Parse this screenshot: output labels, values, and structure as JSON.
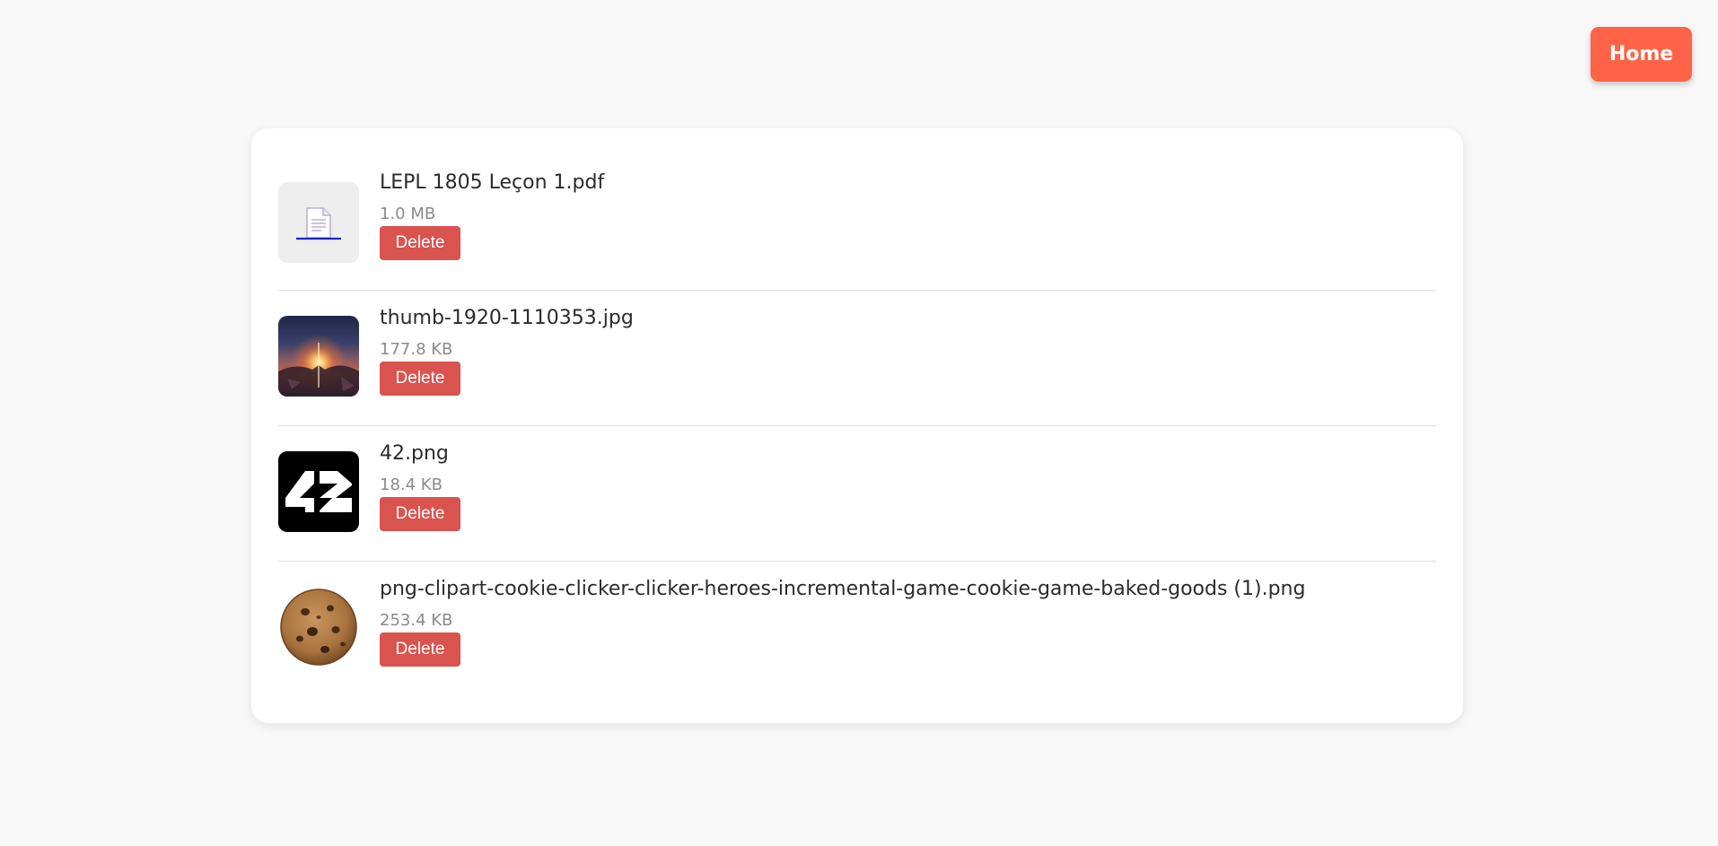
{
  "header": {
    "home_label": "Home"
  },
  "files": [
    {
      "name": "LEPL 1805 Leçon 1.pdf",
      "size": "1.0 MB",
      "delete_label": "Delete",
      "icon": "document-icon"
    },
    {
      "name": "thumb-1920-1110353.jpg",
      "size": "177.8 KB",
      "delete_label": "Delete",
      "icon": "image-thumbnail"
    },
    {
      "name": "42.png",
      "size": "18.4 KB",
      "delete_label": "Delete",
      "icon": "image-thumbnail"
    },
    {
      "name": "png-clipart-cookie-clicker-clicker-heroes-incremental-game-cookie-game-baked-goods (1).png",
      "size": "253.4 KB",
      "delete_label": "Delete",
      "icon": "image-thumbnail"
    }
  ],
  "colors": {
    "home_button": "#ff6347",
    "delete_button": "#d9534f",
    "background": "#f8f8f8",
    "card": "#ffffff"
  }
}
